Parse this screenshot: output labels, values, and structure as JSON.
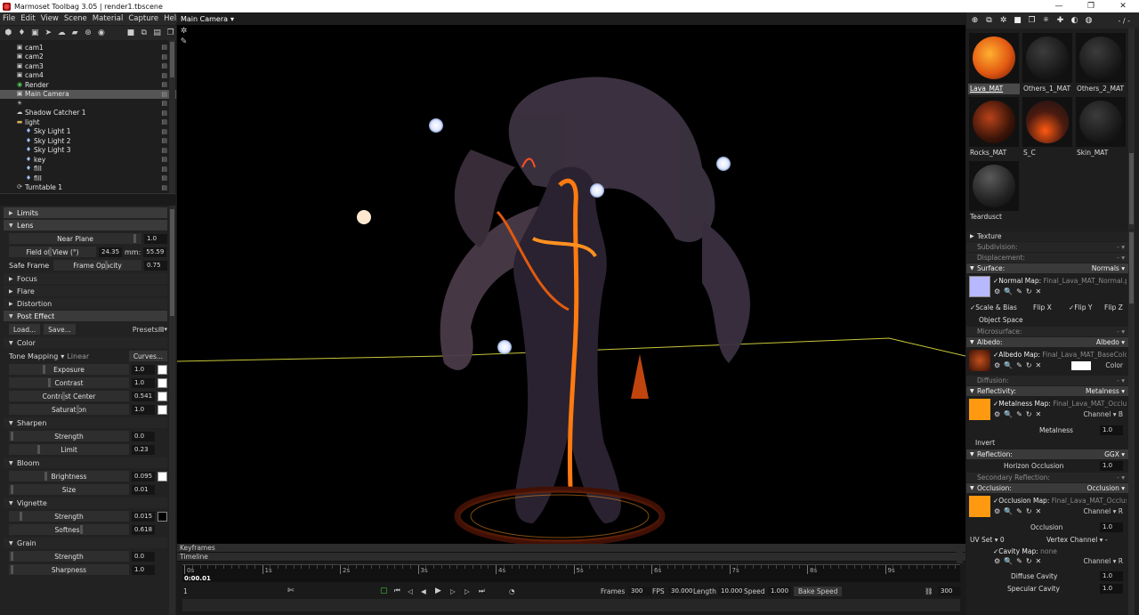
{
  "window": {
    "title": "Marmoset Toolbag 3.05  |  render1.tbscene",
    "min": "—",
    "max": "❐",
    "close": "✕"
  },
  "menu": [
    "File",
    "Edit",
    "View",
    "Scene",
    "Material",
    "Capture",
    "Help"
  ],
  "outliner": [
    {
      "label": "cam1",
      "icon": "camera-icon",
      "indent": 1
    },
    {
      "label": "cam2",
      "icon": "camera-icon",
      "indent": 1
    },
    {
      "label": "cam3",
      "icon": "camera-icon",
      "indent": 1
    },
    {
      "label": "cam4",
      "icon": "camera-icon",
      "indent": 1
    },
    {
      "label": "Render",
      "icon": "render-icon",
      "indent": 1
    },
    {
      "label": "Main Camera",
      "icon": "camera-icon",
      "indent": 1,
      "selected": true
    },
    {
      "label": "",
      "icon": "light-icon",
      "indent": 1
    },
    {
      "label": "Shadow Catcher 1",
      "icon": "shadow-icon",
      "indent": 1
    },
    {
      "label": "light",
      "icon": "folder-icon",
      "indent": 1
    },
    {
      "label": "Sky Light 1",
      "icon": "bulb-icon",
      "indent": 2
    },
    {
      "label": "Sky Light 2",
      "icon": "bulb-icon",
      "indent": 2
    },
    {
      "label": "Sky Light 3",
      "icon": "bulb-icon",
      "indent": 2
    },
    {
      "label": "key",
      "icon": "bulb-icon",
      "indent": 2
    },
    {
      "label": "fill",
      "icon": "bulb-icon",
      "indent": 2
    },
    {
      "label": "fill",
      "icon": "bulb-icon",
      "indent": 2
    },
    {
      "label": "Turntable 1",
      "icon": "turntable-icon",
      "indent": 1
    }
  ],
  "props": {
    "limits": "Limits",
    "lens": "Lens",
    "near_plane": {
      "label": "Near Plane",
      "value": "1.0"
    },
    "fov": {
      "label": "Field of View (°)",
      "value": "24.35",
      "mm_label": "mm:",
      "mm": "55.59"
    },
    "safe_frame": "Safe Frame",
    "frame_opacity": {
      "label": "Frame Opacity",
      "value": "0.75"
    },
    "focus": "Focus",
    "flare": "Flare",
    "distortion": "Distortion",
    "post_effect": "Post Effect",
    "load": "Load...",
    "save": "Save...",
    "presets": "Presets",
    "color": "Color",
    "tone_mapping": "Tone Mapping",
    "tone_value": "Linear",
    "curves": "Curves...",
    "exposure": {
      "label": "Exposure",
      "value": "1.0"
    },
    "contrast": {
      "label": "Contrast",
      "value": "1.0"
    },
    "contrast_center": {
      "label": "Contrast Center",
      "value": "0.541"
    },
    "saturation": {
      "label": "Saturation",
      "value": "1.0"
    },
    "sharpen": "Sharpen",
    "strength": {
      "label": "Strength",
      "value": "0.0"
    },
    "limit": {
      "label": "Limit",
      "value": "0.23"
    },
    "bloom": "Bloom",
    "brightness": {
      "label": "Brightness",
      "value": "0.095"
    },
    "size": {
      "label": "Size",
      "value": "0.01"
    },
    "vignette": "Vignette",
    "v_strength": {
      "label": "Strength",
      "value": "0.015"
    },
    "softness": {
      "label": "Softness",
      "value": "0.618"
    },
    "grain": "Grain",
    "g_strength": {
      "label": "Strength",
      "value": "0.0"
    },
    "sharpness": {
      "label": "Sharpness",
      "value": "1.0"
    }
  },
  "viewport": {
    "camera": "Main Camera"
  },
  "timeline": {
    "keyframes": "Keyframes",
    "timeline": "Timeline",
    "ticks": [
      "0s",
      "1s",
      "2s",
      "3s",
      "4s",
      "5s",
      "6s",
      "7s",
      "8s",
      "9s"
    ],
    "current": "0:00.01",
    "frame": "1",
    "frames_label": "Frames",
    "frames": "300",
    "fps_label": "FPS",
    "fps": "30.000",
    "length_label": "Length",
    "length": "10.000",
    "speed_label": "Speed",
    "speed": "1.000",
    "bake_speed": "Bake Speed",
    "end_frame": "300"
  },
  "materials": [
    {
      "name": "Lava_MAT",
      "selected": true,
      "style": "lava"
    },
    {
      "name": "Others_1_MAT",
      "style": "dark"
    },
    {
      "name": "Others_2_MAT",
      "style": "dark"
    },
    {
      "name": "Rocks_MAT",
      "style": "rock"
    },
    {
      "name": "S_C",
      "style": "sc"
    },
    {
      "name": "Skin_MAT",
      "style": "dark"
    },
    {
      "name": "Teardusct",
      "style": "tear"
    }
  ],
  "mat_top": "- / -",
  "material_props": {
    "texture": "Texture",
    "subdivision": "Subdivision:",
    "displacement": "Displacement:",
    "surface": "Surface:",
    "surface_val": "Normals ▾",
    "normal_map": "✓Normal Map:",
    "normal_file": "Final_Lava_MAT_Normal.p",
    "scale_bias": "✓Scale & Bias",
    "flip_x": "Flip X",
    "flip_y": "✓Flip Y",
    "flip_z": "Flip Z",
    "object_space": "Object Space",
    "microsurface": "Microsurface:",
    "albedo": "Albedo:",
    "albedo_val": "Albedo ▾",
    "albedo_map": "✓Albedo Map:",
    "albedo_file": "Final_Lava_MAT_BaseColor",
    "color_label": "Color",
    "diffusion": "Diffusion:",
    "reflectivity": "Reflectivity:",
    "reflectivity_val": "Metalness ▾",
    "metal_map": "✓Metalness Map:",
    "metal_file": "Final_Lava_MAT_Occlus",
    "channel_b": "Channel ▾ B",
    "metalness": "Metalness",
    "metalness_val": "1.0",
    "invert": "Invert",
    "reflection": "Reflection:",
    "reflection_val": "GGX ▾",
    "horizon": "Horizon Occlusion",
    "horizon_val": "1.0",
    "secondary": "Secondary Reflection:",
    "occlusion": "Occlusion:",
    "occlusion_val": "Occlusion ▾",
    "occ_map": "✓Occlusion Map:",
    "occ_file": "Final_Lava_MAT_Occlus",
    "channel_r": "Channel ▾ R",
    "occ_label": "Occlusion",
    "occ_num": "1.0",
    "uv_set": "UV Set ▾ 0",
    "vertex_channel": "Vertex Channel ▾ -",
    "cavity_map": "✓Cavity Map:",
    "cavity_file": "none",
    "channel_r2": "Channel ▾ R",
    "diffuse_cavity": "Diffuse Cavity",
    "diffuse_cavity_val": "1.0",
    "specular_cavity": "Specular Cavity",
    "specular_cavity_val": "1.0"
  },
  "colors": {
    "accent": "#e07a10",
    "selection": "#555555",
    "horizon": "#c8c83a"
  }
}
